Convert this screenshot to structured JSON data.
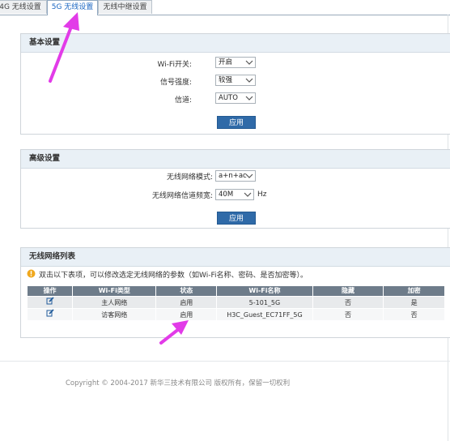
{
  "tabs": [
    {
      "label": "4G 无线设置"
    },
    {
      "label": "5G 无线设置",
      "active": true
    },
    {
      "label": "无线中继设置"
    }
  ],
  "basic": {
    "title": "基本设置",
    "wifi_switch_label": "Wi-Fi开关:",
    "wifi_switch_value": "开启",
    "signal_label": "信号强度:",
    "signal_value": "较强",
    "channel_label": "信道:",
    "channel_value": "AUTO",
    "apply_label": "应用"
  },
  "advanced": {
    "title": "高级设置",
    "mode_label": "无线网络模式:",
    "mode_value": "a+n+ac",
    "bandwidth_label": "无线网络信道频宽:",
    "bandwidth_value": "40M",
    "bandwidth_unit": "Hz",
    "apply_label": "应用"
  },
  "list": {
    "title": "无线网络列表",
    "hint": "双击以下表项，可以修改选定无线网络的参数（如Wi-Fi名称、密码、是否加密等）。",
    "columns": [
      "操作",
      "Wi-Fi类型",
      "状态",
      "Wi-Fi名称",
      "隐藏",
      "加密"
    ],
    "rows": [
      {
        "type": "主人网络",
        "status": "启用",
        "name": "5-101_5G",
        "hidden": "否",
        "encrypted": "是"
      },
      {
        "type": "访客网络",
        "status": "启用",
        "name": "H3C_Guest_EC71FF_5G",
        "hidden": "否",
        "encrypted": "否"
      }
    ]
  },
  "footer": {
    "copyright": "Copyright © 2004-2017 新华三技术有限公司 版权所有，保留一切权利"
  },
  "colors": {
    "accent": "#2f6aa8",
    "annotation_arrow": "#e23be8"
  },
  "icons": {
    "edit": "edit-icon",
    "warning": "warning-icon"
  }
}
